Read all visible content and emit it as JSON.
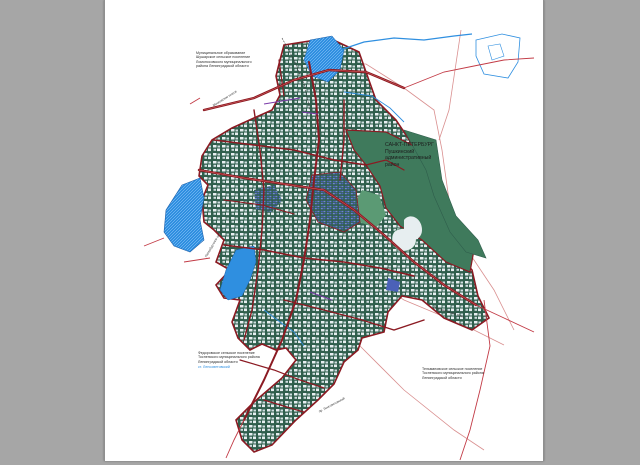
{
  "labels": {
    "district_main": [
      "САНКТ-ПЕТЕРБУРГ",
      "Пушкинский",
      "административный",
      "район"
    ],
    "north_west": [
      "Муниципальное образование",
      "Шушарское сельское поселение",
      "Ломоносовского муниципального",
      "района Ленинградской области"
    ],
    "south_west": [
      "Федоровское сельское поселение",
      "Тосненского муниципального района",
      "Ленинградской области"
    ],
    "south_west_small": "ст. Ленсоветовский",
    "south_east": [
      "Тельмановское сельское поселение",
      "Тосненского муниципального района",
      "Ленинградской области"
    ],
    "road_labels": [
      "Московское шоссе",
      "Петербургское шоссе",
      "Ленсоветовский тракт",
      "пр. Ленсоветовский"
    ]
  },
  "colors": {
    "viewer_bg": "#a6a6a6",
    "page_bg": "#ffffff",
    "territory": "#2f5e4c",
    "park": "#3f7a5c",
    "road": "#8b1a22",
    "road_edge": "#d98f8f",
    "water": "#2f8fe0",
    "block": "#e7eef0",
    "block_blue": "#4b61b8",
    "block_purple": "#7a3aa8"
  }
}
